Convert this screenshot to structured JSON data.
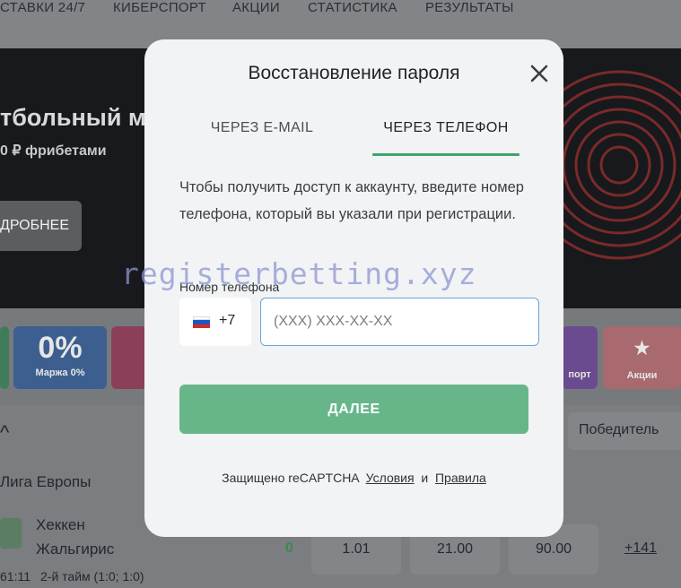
{
  "nav": {
    "items": [
      "СТАВКИ 24/7",
      "КИБЕРСПОРТ",
      "АКЦИИ",
      "СТАТИСТИКА",
      "РЕЗУЛЬТАТЫ"
    ]
  },
  "banner": {
    "title": "тбольный ма",
    "subtitle": "0 ₽ фрибетами",
    "button": "ДРОБНЕЕ"
  },
  "tiles": {
    "margin_value": "0%",
    "margin_label": "Маржа 0%",
    "esport_label": "порт",
    "promo_label": "Акции"
  },
  "list": {
    "sort_label": "Победитель",
    "league": "Лига Европы",
    "team1": "Хеккен",
    "team2": "Жальгирис",
    "score": "0",
    "odds": [
      "1.01",
      "21.00",
      "90.00"
    ],
    "more": "+141",
    "time": "61:11",
    "period": "2-й тайм (1:0; 1:0)"
  },
  "watermark": "registerbetting.xyz",
  "modal": {
    "title": "Восстановление пароля",
    "tabs": {
      "email": "ЧЕРЕЗ E-MAIL",
      "phone": "ЧЕРЕЗ ТЕЛЕФОН",
      "active": "phone"
    },
    "description": "Чтобы получить доступ к аккаунту, введите номер телефона, который вы указали при регистрации.",
    "phone_label": "Номер телефона",
    "country_code": "+7",
    "phone_value": "",
    "phone_placeholder": "(XXX) XXX-XX-XX",
    "next_button": "ДАЛЕЕ",
    "recaptcha": {
      "prefix": "Защищено reCAPTCHA",
      "terms": "Условия",
      "and": "и",
      "rules": "Правила"
    }
  },
  "colors": {
    "accent_green": "#67b68a",
    "tab_underline": "#3fa36d",
    "input_border": "#6aa6d8",
    "overlay": "#7d7f82"
  }
}
